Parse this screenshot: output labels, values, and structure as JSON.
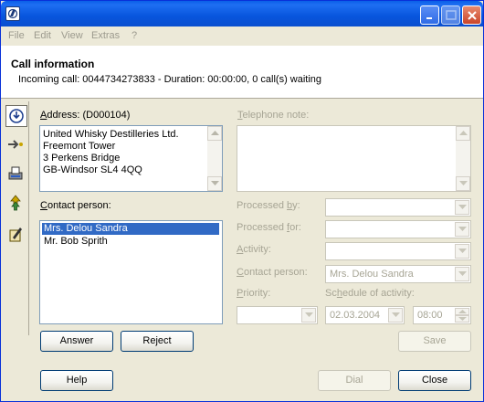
{
  "menu": [
    "File",
    "Edit",
    "View",
    "Extras",
    "?"
  ],
  "header": {
    "title": "Call information",
    "status": "Incoming call: 0044734273833 - Duration: 00:00:00, 0 call(s) waiting"
  },
  "address": {
    "label_key": "A",
    "label_rest": "ddress: (D000104)",
    "lines": [
      "United Whisky Destilleries Ltd.",
      "Freemont Tower",
      "3 Perkens Bridge",
      "GB-Windsor SL4 4QQ"
    ]
  },
  "contact": {
    "label_key": "C",
    "label_rest": "ontact person:",
    "items": [
      "Mrs. Delou Sandra",
      "Mr. Bob Sprith"
    ],
    "selected_index": 0
  },
  "telephone_note": {
    "label_key": "T",
    "label_rest": "elephone note:"
  },
  "fields": {
    "processed_by": {
      "label_pre": "Processed ",
      "label_key": "b",
      "label_post": "y:"
    },
    "processed_for": {
      "label_pre": "Processed ",
      "label_key": "f",
      "label_post": "or:"
    },
    "activity": {
      "label_pre": "",
      "label_key": "A",
      "label_post": "ctivity:"
    },
    "contact_person": {
      "label_pre": "",
      "label_key": "C",
      "label_post": "ontact person:",
      "value": "Mrs. Delou Sandra"
    },
    "priority": {
      "label_pre": "",
      "label_key": "P",
      "label_post": "riority:"
    },
    "schedule": {
      "label_pre": "Sc",
      "label_key": "h",
      "label_post": "edule of activity:",
      "date": "02.03.2004",
      "time": "08:00"
    }
  },
  "buttons": {
    "answer": "Answer",
    "reject": "Reject",
    "save": "Save",
    "help": "Help",
    "dial": "Dial",
    "close": "Close"
  }
}
